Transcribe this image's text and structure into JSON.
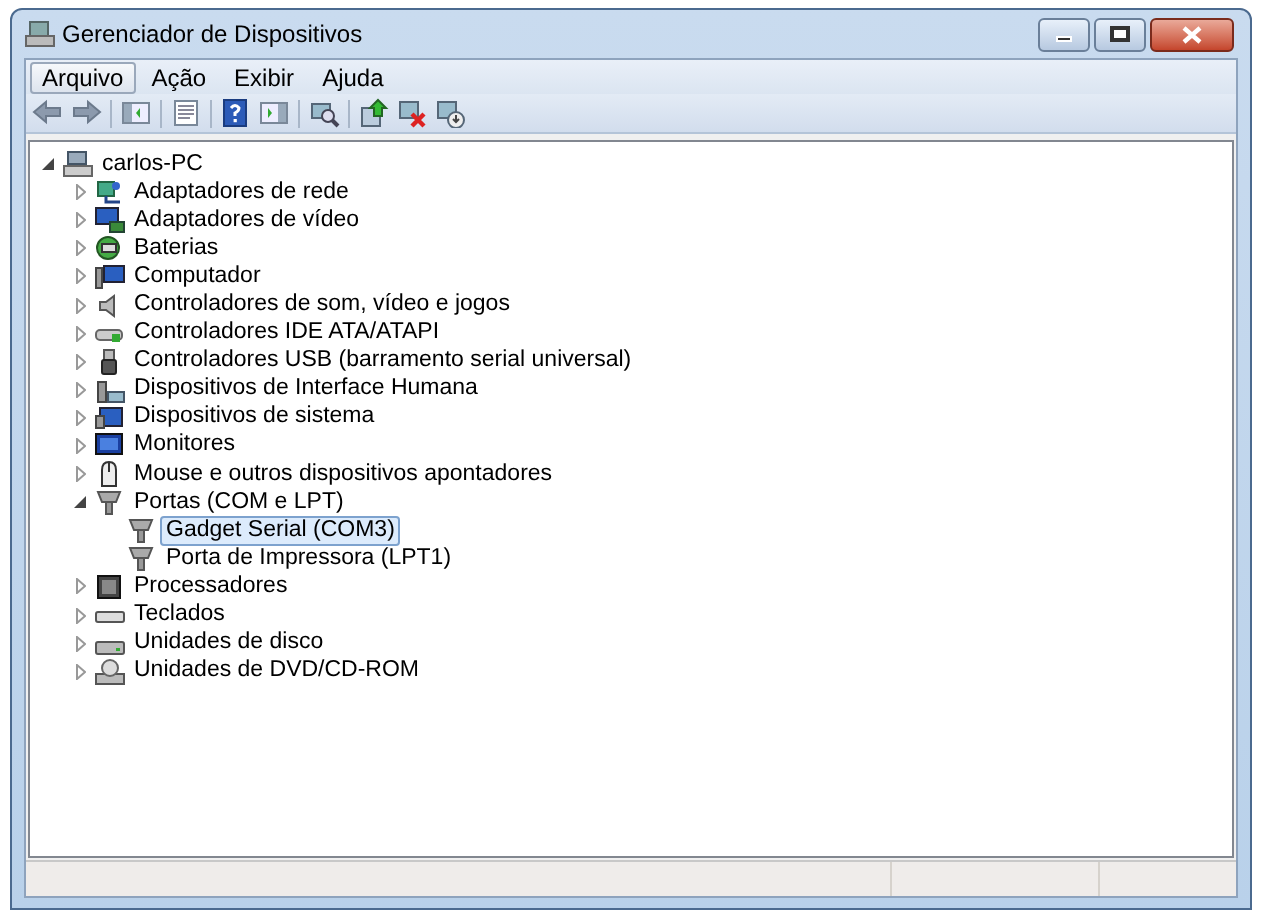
{
  "window": {
    "title": "Gerenciador de Dispositivos"
  },
  "menu": [
    {
      "label": "Arquivo",
      "selected": true
    },
    {
      "label": "Ação",
      "selected": false
    },
    {
      "label": "Exibir",
      "selected": false
    },
    {
      "label": "Ajuda",
      "selected": false
    }
  ],
  "tree": [
    {
      "label": "carlos-PC",
      "expanded": true,
      "selected": false,
      "children": [
        {
          "label": "Adaptadores de rede",
          "expanded": false,
          "selected": false
        },
        {
          "label": "Adaptadores de vídeo",
          "expanded": false,
          "selected": false
        },
        {
          "label": "Baterias",
          "expanded": false,
          "selected": false
        },
        {
          "label": "Computador",
          "expanded": false,
          "selected": false
        },
        {
          "label": "Controladores de som, vídeo e jogos",
          "expanded": false,
          "selected": false
        },
        {
          "label": "Controladores IDE ATA/ATAPI",
          "expanded": false,
          "selected": false
        },
        {
          "label": "Controladores USB (barramento serial universal)",
          "expanded": false,
          "selected": false
        },
        {
          "label": "Dispositivos de Interface Humana",
          "expanded": false,
          "selected": false
        },
        {
          "label": "Dispositivos de sistema",
          "expanded": false,
          "selected": false
        },
        {
          "label": "Monitores",
          "expanded": false,
          "selected": false
        },
        {
          "label": "Mouse e outros dispositivos apontadores",
          "expanded": false,
          "selected": false
        },
        {
          "label": "Portas (COM e LPT)",
          "expanded": true,
          "selected": false,
          "children": [
            {
              "label": "Gadget Serial (COM3)",
              "selected": true
            },
            {
              "label": "Porta de Impressora (LPT1)",
              "selected": false
            }
          ]
        },
        {
          "label": "Processadores",
          "expanded": false,
          "selected": false
        },
        {
          "label": "Teclados",
          "expanded": false,
          "selected": false
        },
        {
          "label": "Unidades de disco",
          "expanded": false,
          "selected": false
        },
        {
          "label": "Unidades de DVD/CD-ROM",
          "expanded": false,
          "selected": false
        }
      ]
    }
  ]
}
